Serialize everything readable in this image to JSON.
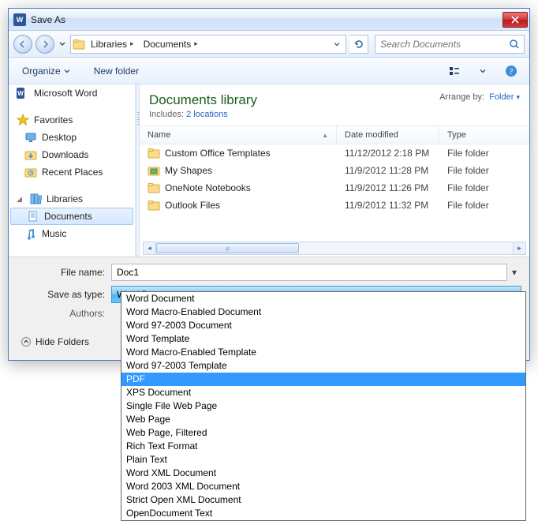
{
  "window": {
    "title": "Save As"
  },
  "breadcrumbs": [
    "Libraries",
    "Documents"
  ],
  "search": {
    "placeholder": "Search Documents"
  },
  "toolbar": {
    "organize": "Organize",
    "newfolder": "New folder"
  },
  "sidebar": {
    "word": "Microsoft Word",
    "favorites": "Favorites",
    "fav_items": [
      "Desktop",
      "Downloads",
      "Recent Places"
    ],
    "libraries": "Libraries",
    "lib_items": [
      "Documents",
      "Music"
    ]
  },
  "library": {
    "title": "Documents library",
    "includes_label": "Includes:",
    "includes_link": "2 locations",
    "arrange_label": "Arrange by:",
    "arrange_value": "Folder"
  },
  "columns": {
    "name": "Name",
    "date": "Date modified",
    "type": "Type"
  },
  "rows": [
    {
      "name": "Custom Office Templates",
      "date": "11/12/2012 2:18 PM",
      "type": "File folder",
      "icon": "folder"
    },
    {
      "name": "My Shapes",
      "date": "11/9/2012 11:28 PM",
      "type": "File folder",
      "icon": "visio"
    },
    {
      "name": "OneNote Notebooks",
      "date": "11/9/2012 11:26 PM",
      "type": "File folder",
      "icon": "folder"
    },
    {
      "name": "Outlook Files",
      "date": "11/9/2012 11:32 PM",
      "type": "File folder",
      "icon": "folder"
    }
  ],
  "form": {
    "filename_label": "File name:",
    "filename_value": "Doc1",
    "savetype_label": "Save as type:",
    "savetype_value": "Word Document",
    "authors_label": "Authors:",
    "hide_folders": "Hide Folders"
  },
  "type_options": [
    "Word Document",
    "Word Macro-Enabled Document",
    "Word 97-2003 Document",
    "Word Template",
    "Word Macro-Enabled Template",
    "Word 97-2003 Template",
    "PDF",
    "XPS Document",
    "Single File Web Page",
    "Web Page",
    "Web Page, Filtered",
    "Rich Text Format",
    "Plain Text",
    "Word XML Document",
    "Word 2003 XML Document",
    "Strict Open XML Document",
    "OpenDocument Text"
  ],
  "type_selected": "PDF"
}
